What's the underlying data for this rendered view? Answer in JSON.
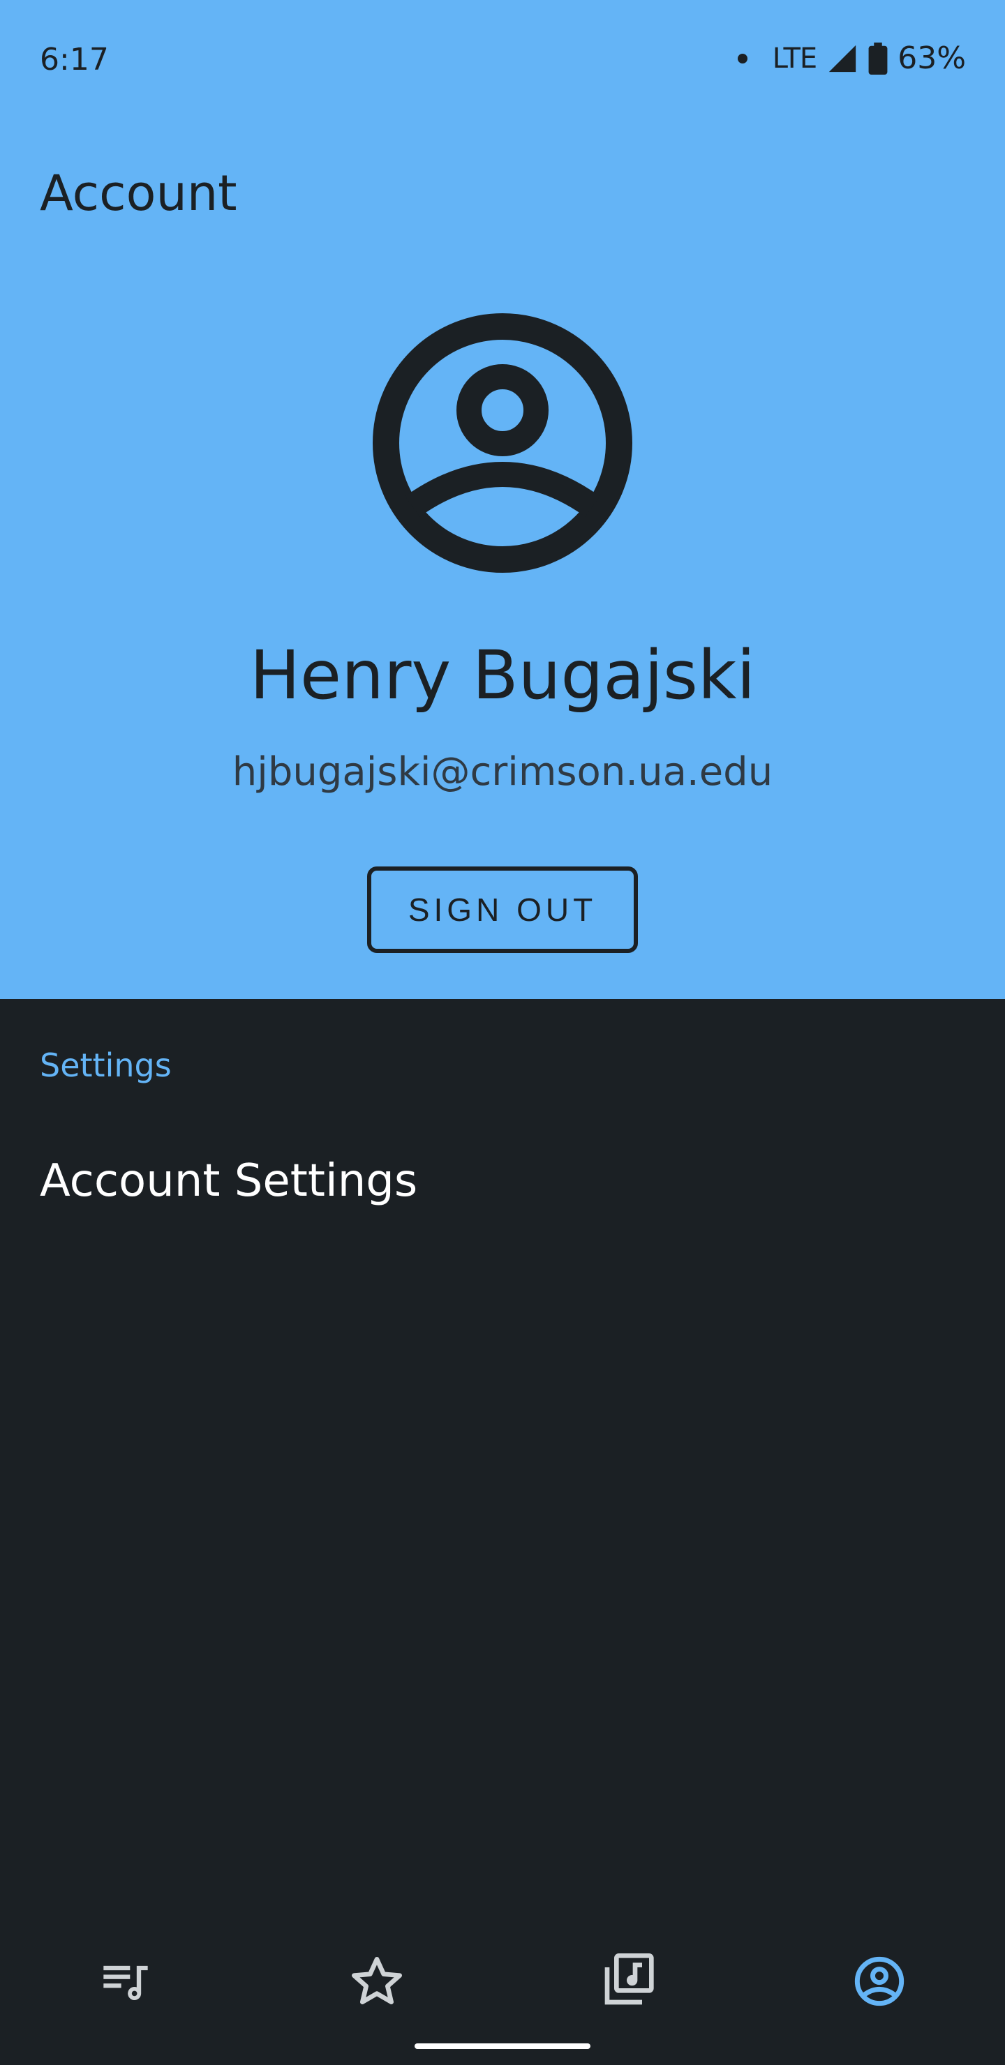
{
  "status_bar": {
    "time": "6:17",
    "network": "LTE",
    "battery": "63%"
  },
  "header": {
    "title": "Account"
  },
  "profile": {
    "avatar_icon": "account-circle-icon",
    "name": "Henry Bugajski",
    "email": "hjbugajski@crimson.ua.edu",
    "sign_out_label": "SIGN OUT"
  },
  "settings": {
    "section_label": "Settings",
    "items": [
      {
        "label": "Account Settings"
      }
    ]
  },
  "bottom_nav": {
    "items": [
      {
        "icon": "queue-music-icon",
        "active": false
      },
      {
        "icon": "star-outline-icon",
        "active": false
      },
      {
        "icon": "library-music-icon",
        "active": false
      },
      {
        "icon": "account-circle-icon",
        "active": true
      }
    ]
  },
  "colors": {
    "header_bg": "#64b4f6",
    "body_bg": "#1b2024",
    "accent": "#64b4f6",
    "text_dark": "#1b2024",
    "text_light": "#ffffff",
    "icon_inactive": "#cfd3d6"
  }
}
